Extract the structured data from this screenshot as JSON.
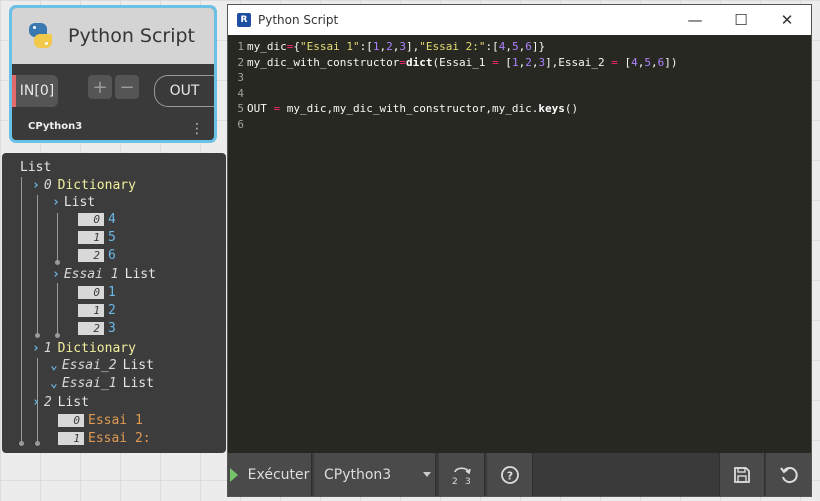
{
  "node": {
    "title": "Python Script",
    "input_port": "IN[0]",
    "add_label": "+",
    "remove_label": "−",
    "output_port": "OUT",
    "engine": "CPython3",
    "menu_glyph": "⋮"
  },
  "preview": {
    "root": "List",
    "rows": [
      {
        "chev": "›",
        "index": "0",
        "label": "Dictionary"
      },
      {
        "chev": "›",
        "label": "List"
      },
      {
        "box": "0",
        "value": "4"
      },
      {
        "box": "1",
        "value": "5"
      },
      {
        "box": "2",
        "value": "6"
      },
      {
        "chev": "›",
        "index": "Essai 1",
        "label": "List"
      },
      {
        "box": "0",
        "value": "1"
      },
      {
        "box": "1",
        "value": "2"
      },
      {
        "box": "2",
        "value": "3"
      },
      {
        "chev": "›",
        "index": "1",
        "label": "Dictionary"
      },
      {
        "chev": "⌄",
        "index": "Essai_2",
        "label": "List"
      },
      {
        "chev": "⌄",
        "index": "Essai_1",
        "label": "List"
      },
      {
        "chev": "›",
        "index": "2",
        "label": "List"
      },
      {
        "box": "0",
        "value": "Essai 1"
      },
      {
        "box": "1",
        "value": "Essai 2:"
      }
    ]
  },
  "window": {
    "title": "Python Script",
    "app_icon": "R",
    "minimize": "—",
    "maximize": "☐",
    "close": "✕"
  },
  "editor": {
    "line_numbers": [
      "1",
      "2",
      "3",
      "4",
      "5",
      "6"
    ],
    "lines": [
      "my_dic={\"Essai 1\":[1,2,3],\"Essai 2:\":[4,5,6]}",
      "my_dic_with_constructor=dict(Essai_1 = [1,2,3],Essai_2 = [4,5,6])",
      "",
      "",
      "OUT = my_dic,my_dic_with_constructor,my_dic.keys()",
      ""
    ]
  },
  "toolbar": {
    "run_label": "Exécuter",
    "engine_value": "CPython3",
    "convert_label": "2 3",
    "help_label": "?",
    "save_icon": "save-icon",
    "revert_icon": "revert-icon"
  }
}
